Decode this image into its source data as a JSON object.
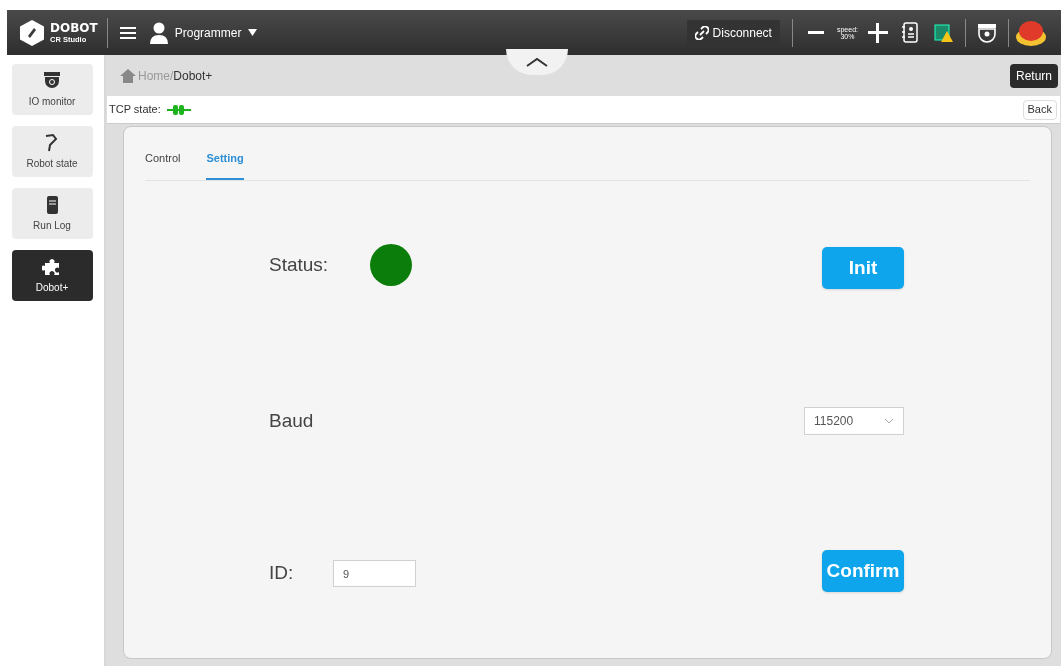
{
  "header": {
    "brand": "DOBOT",
    "product": "CR Studio",
    "user": "Programmer",
    "disconnect": "Disconnect",
    "speed_label": "speed:",
    "speed_value": "30%"
  },
  "sidebar": {
    "items": [
      {
        "label": "IO monitor",
        "kind": "camera",
        "selected": false
      },
      {
        "label": "Robot state",
        "kind": "arm",
        "selected": false
      },
      {
        "label": "Run Log",
        "kind": "log",
        "selected": false
      },
      {
        "label": "Dobot+",
        "kind": "puzzle",
        "selected": true
      }
    ]
  },
  "breadcrumb": {
    "home": "Home/",
    "current": "Dobot+"
  },
  "return_button": "Return",
  "tcp": {
    "label": "TCP state:",
    "connected": true
  },
  "back_button": "Back",
  "tabs": [
    {
      "label": "Control",
      "selected": false
    },
    {
      "label": "Setting",
      "selected": true
    }
  ],
  "settings": {
    "status_label": "Status:",
    "status_on": true,
    "init_button": "Init",
    "baud_label": "Baud",
    "baud_value": "115200",
    "id_label": "ID:",
    "id_value": "9",
    "confirm_button": "Confirm"
  }
}
